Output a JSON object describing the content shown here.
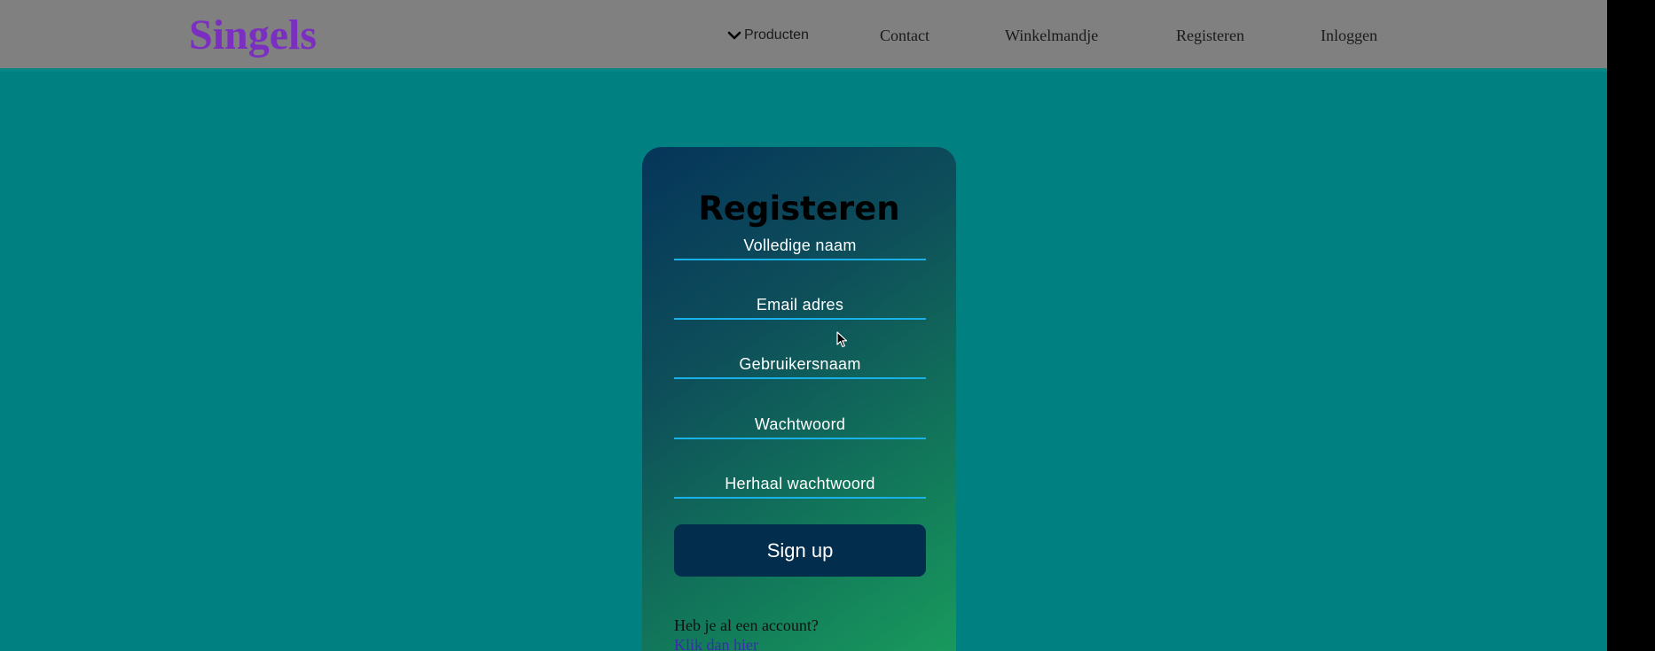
{
  "header": {
    "brand": "Singels",
    "nav": {
      "products": "Producten",
      "contact": "Contact",
      "cart": "Winkelmandje",
      "register": "Registeren",
      "login": "Inloggen"
    }
  },
  "form": {
    "title": "Registeren",
    "fields": {
      "full_name": "Volledige naam",
      "email": "Email adres",
      "username": "Gebruikersnaam",
      "password": "Wachtwoord",
      "repeat_password": "Herhaal wachtwoord"
    },
    "submit_label": "Sign up",
    "account_question": "Heb je al een account?",
    "account_link": "Klik dan hier"
  },
  "colors": {
    "page_background": "#008080",
    "navbar": "#808080",
    "brand": "#7a2fc0",
    "field_underline": "#19b2e8",
    "button": "#032d4d"
  },
  "icons": {
    "dropdown": "chevron-down-icon",
    "pointer": "mouse-cursor-icon"
  }
}
